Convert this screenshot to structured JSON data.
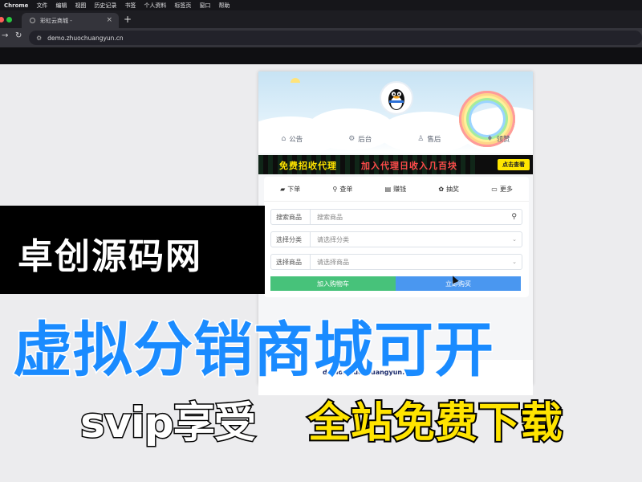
{
  "menubar": {
    "items": [
      "Chrome",
      "文件",
      "编辑",
      "视图",
      "历史记录",
      "书签",
      "个人资料",
      "标签页",
      "窗口",
      "帮助"
    ]
  },
  "tab": {
    "title": "彩虹云商城 -",
    "close_icon": "close-icon"
  },
  "new_tab_label": "+",
  "address_bar": {
    "url": "demo.zhuochuangyun.cn"
  },
  "shop": {
    "top_menu": [
      {
        "icon": "bullhorn-icon",
        "label": "公告"
      },
      {
        "icon": "gears-icon",
        "label": "后台"
      },
      {
        "icon": "user-icon",
        "label": "售后"
      },
      {
        "icon": "diamond-icon",
        "label": "领赞"
      }
    ],
    "banner": {
      "left_text": "免费招收代理",
      "right_text": "加入代理日收入几百块",
      "button": "点击查看"
    },
    "panel_tabs": [
      {
        "icon": "cart-icon",
        "label": "下单"
      },
      {
        "icon": "search-icon",
        "label": "查单"
      },
      {
        "icon": "money-icon",
        "label": "赚钱"
      },
      {
        "icon": "gift-icon",
        "label": "抽奖"
      },
      {
        "icon": "folder-icon",
        "label": "更多"
      }
    ],
    "search": {
      "label": "搜索商品",
      "placeholder": "搜索商品"
    },
    "category": {
      "label": "选择分类",
      "value": "请选择分类"
    },
    "product": {
      "label": "选择商品",
      "value": "请选择商品"
    },
    "add_cart_label": "加入购物车",
    "buy_label": "立即购买",
    "footer_site": "demo.zhuochuangyun.cn"
  },
  "colors": {
    "accent_blue": "#1a8bff",
    "cart_green": "#47c27a",
    "buy_blue": "#4a97f0",
    "banner_yellow": "#ffe600"
  },
  "overlay": {
    "logo": "卓创源码网",
    "headline": "虚拟分销商城可开",
    "svip": "svip享受",
    "free_download": "全站免费下载"
  }
}
